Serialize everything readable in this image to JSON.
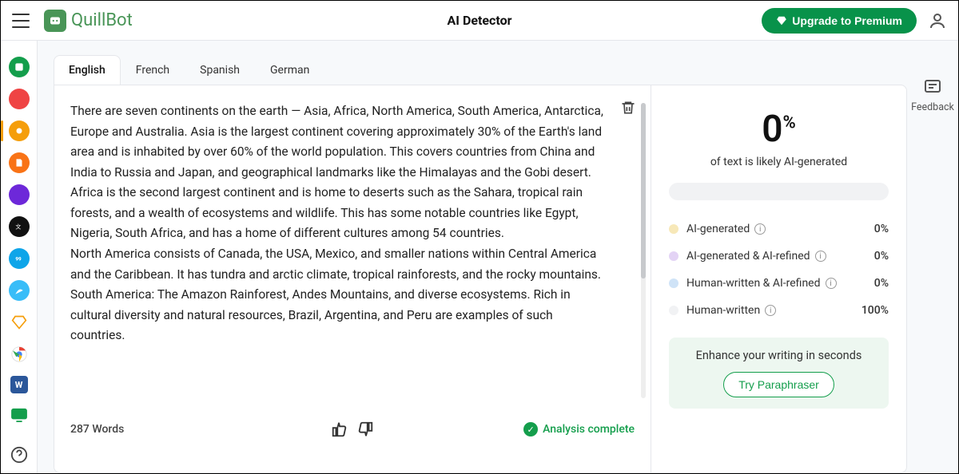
{
  "header": {
    "brand": "QuillBot",
    "title": "AI Detector",
    "upgrade": "Upgrade to Premium"
  },
  "tabs": {
    "t0": "English",
    "t1": "French",
    "t2": "Spanish",
    "t3": "German"
  },
  "text": {
    "p1": "There are seven continents on the earth  — Asia, Africa, North America, South America, Antarctica, Europe and Australia. Asia is the largest continent covering approximately 30% of the Earth's land  area and is inhabited by over 60% of the world population. This covers countries from China and India to Russia and Japan, and geographical landmarks like the Himalayas and the Gobi desert.",
    "p2": "Africa is the second largest continent and is home  to deserts such as the Sahara, tropical rain forests, and a wealth of ecosystems and wildlife. This has some  notable countries like Egypt, Nigeria, South Africa, and has a home of different cultures among 54 countries.",
    "p3": "North America consists of Canada, the USA, Mexico,  and smaller nations within Central America and the Caribbean. It has tundra and arctic climate, tropical rainforests, and the rocky  mountains.",
    "p4": "South America: The Amazon Rainforest, Andes Mountains, and diverse  ecosystems. Rich in cultural diversity and natural resources, Brazil, Argentina,  and Peru are examples of such countries."
  },
  "footer": {
    "words": "287 Words",
    "status": "Analysis complete"
  },
  "results": {
    "percent": "0",
    "percent_symbol": "%",
    "caption": "of text is likely AI-generated",
    "legend": {
      "r1": {
        "label": "AI-generated",
        "value": "0%",
        "color": "#f7e8b8"
      },
      "r2": {
        "label": "AI-generated & AI-refined",
        "value": "0%",
        "color": "#e3d3f5"
      },
      "r3": {
        "label": "Human-written & AI-refined",
        "value": "0%",
        "color": "#cfe3f7"
      },
      "r4": {
        "label": "Human-written",
        "value": "100%",
        "color": "#f1f2f4"
      }
    },
    "promo_text": "Enhance your writing in seconds",
    "promo_btn": "Try Paraphraser"
  },
  "right": {
    "feedback": "Feedback"
  },
  "rail": {
    "c1": "#149e4c",
    "c2": "#ef4444",
    "c3": "#f59e0b",
    "c4": "#f97316",
    "c5": "#6d28d9",
    "c6": "#111",
    "c7": "#0ea5e9",
    "c8": "#38bdf8",
    "c9": "#f59e0b"
  }
}
